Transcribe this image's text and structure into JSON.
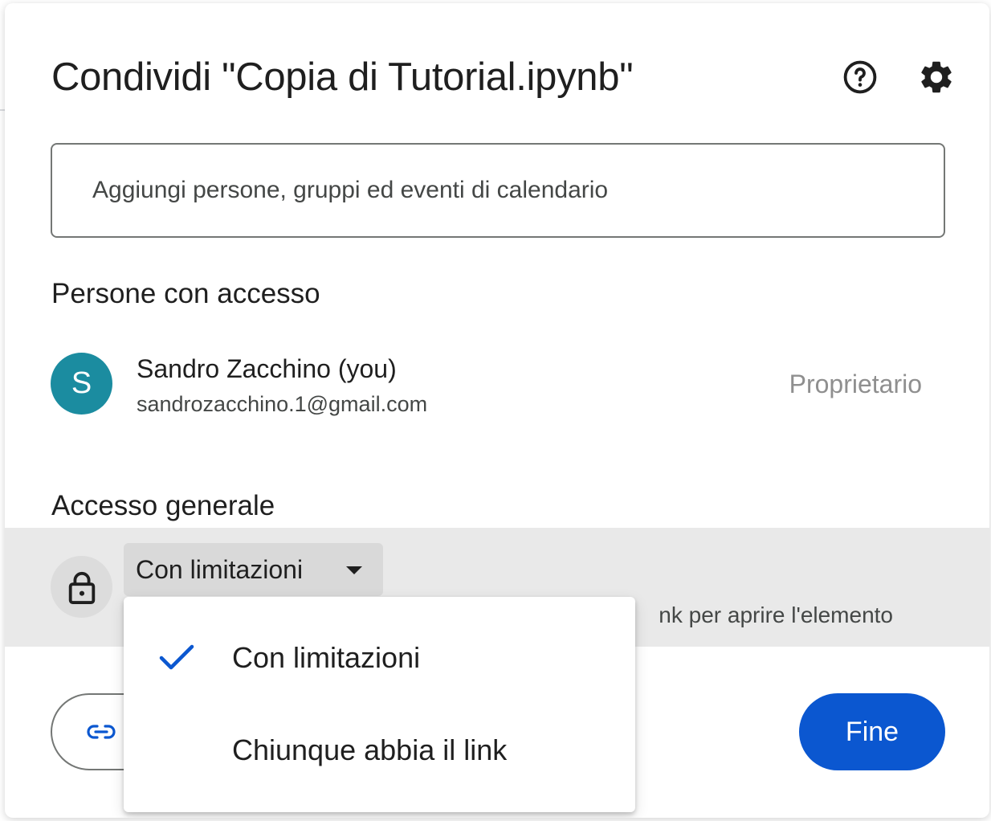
{
  "dialog": {
    "title": "Condividi \"Copia di Tutorial.ipynb\"",
    "help_icon": "help-circle-icon",
    "settings_icon": "gear-icon"
  },
  "add_people": {
    "placeholder": "Aggiungi persone, gruppi ed eventi di calendario"
  },
  "people_section": {
    "title": "Persone con accesso",
    "people": [
      {
        "avatar_letter": "S",
        "avatar_color": "#1b8ca0",
        "name": "Sandro Zacchino (you)",
        "email": "sandrozacchino.1@gmail.com",
        "role": "Proprietario"
      }
    ]
  },
  "general_access": {
    "title": "Accesso generale",
    "icon": "lock-icon",
    "selected": "Con limitazioni",
    "description_visible": "nk per aprire l'elemento"
  },
  "dropdown_menu": {
    "items": [
      {
        "label": "Con limitazioni",
        "selected": true
      },
      {
        "label": "Chiunque abbia il link",
        "selected": false
      }
    ]
  },
  "footer": {
    "copy_link_icon": "link-icon",
    "done_label": "Fine"
  },
  "colors": {
    "primary": "#0b57d0",
    "avatar": "#1b8ca0",
    "row_highlight": "#e9e9e9"
  }
}
